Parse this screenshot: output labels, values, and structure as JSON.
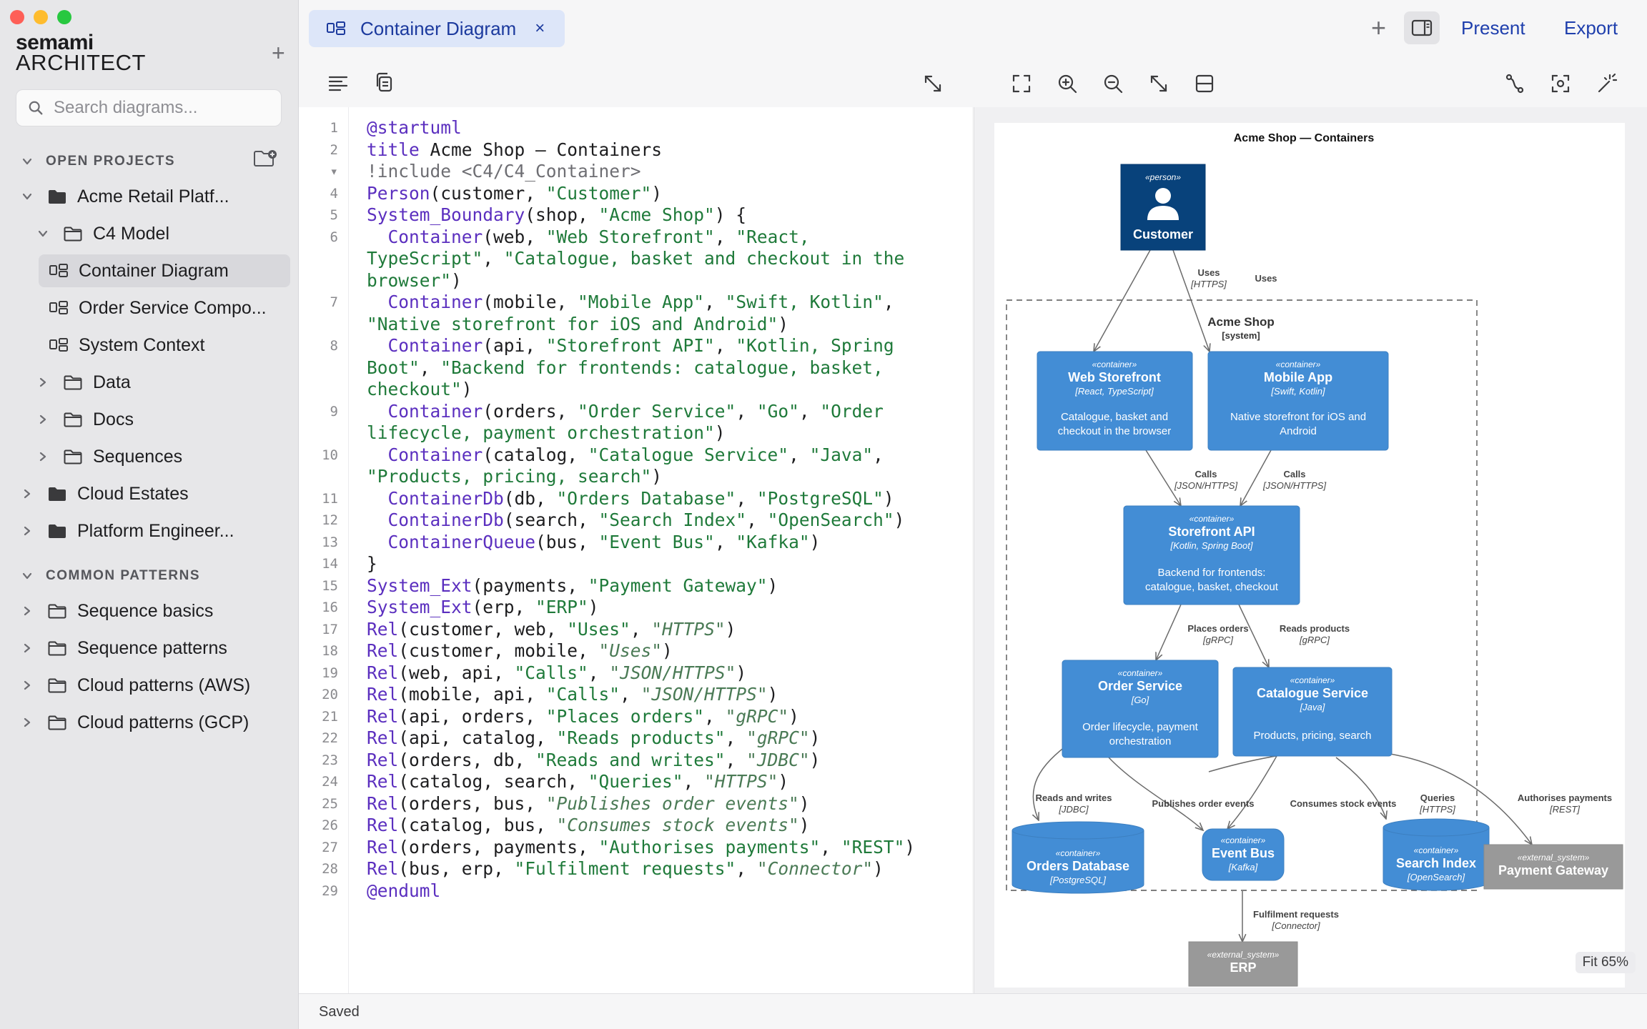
{
  "app": {
    "logo_line1": "semami",
    "logo_line2": "ARCHITECT",
    "traffic_colors": [
      "#fe5f57",
      "#febc2e",
      "#28c840"
    ]
  },
  "sidebar": {
    "search_placeholder": "Search diagrams...",
    "open_projects_header": "OPEN PROJECTS",
    "common_patterns_header": "COMMON PATTERNS",
    "open_projects": [
      {
        "label": "Acme Retail Platf...",
        "level": 0,
        "type": "folder-filled",
        "state": "expanded"
      },
      {
        "label": "C4 Model",
        "level": 1,
        "type": "folder",
        "state": "expanded"
      },
      {
        "label": "Container Diagram",
        "level": 2,
        "type": "diagram",
        "state": "leaf",
        "selected": true
      },
      {
        "label": "Order Service Compo...",
        "level": 2,
        "type": "diagram",
        "state": "leaf"
      },
      {
        "label": "System Context",
        "level": 2,
        "type": "diagram",
        "state": "leaf"
      },
      {
        "label": "Data",
        "level": 1,
        "type": "folder",
        "state": "collapsed"
      },
      {
        "label": "Docs",
        "level": 1,
        "type": "folder",
        "state": "collapsed"
      },
      {
        "label": "Sequences",
        "level": 1,
        "type": "folder",
        "state": "collapsed"
      },
      {
        "label": "Cloud Estates",
        "level": 0,
        "type": "folder-filled",
        "state": "collapsed"
      },
      {
        "label": "Platform Engineer...",
        "level": 0,
        "type": "folder-filled",
        "state": "collapsed"
      }
    ],
    "common_patterns": [
      {
        "label": "Sequence basics"
      },
      {
        "label": "Sequence patterns"
      },
      {
        "label": "Cloud patterns (AWS)"
      },
      {
        "label": "Cloud patterns (GCP)"
      }
    ]
  },
  "topbar": {
    "tab_label": "Container Diagram",
    "tab_close": "×",
    "add_symbol": "+",
    "present_label": "Present",
    "export_label": "Export"
  },
  "editor": {
    "lines": [
      {
        "n": "1",
        "parts": [
          [
            "at",
            "@startuml"
          ]
        ]
      },
      {
        "n": "2",
        "parts": [
          [
            "k",
            "title"
          ],
          [
            "",
            " Acme Shop — Containers"
          ]
        ]
      },
      {
        "n": "▾",
        "parts": [
          [
            "cm",
            "!include <C4/C4_Container>"
          ]
        ]
      },
      {
        "n": "4",
        "parts": [
          [
            "k",
            "Person"
          ],
          [
            "",
            "(customer, "
          ],
          [
            "s",
            "\"Customer\""
          ],
          [
            "",
            ")"
          ]
        ]
      },
      {
        "n": "5",
        "parts": [
          [
            "k",
            "System_Boundary"
          ],
          [
            "",
            "(shop, "
          ],
          [
            "s",
            "\"Acme Shop\""
          ],
          [
            "",
            ") {"
          ]
        ]
      },
      {
        "n": "6",
        "parts": [
          [
            "",
            "  "
          ],
          [
            "k",
            "Container"
          ],
          [
            "",
            "(web, "
          ],
          [
            "s",
            "\"Web Storefront\""
          ],
          [
            "",
            ", "
          ],
          [
            "s",
            "\"React,"
          ]
        ]
      },
      {
        "n": "",
        "parts": [
          [
            "s",
            "TypeScript\""
          ],
          [
            "",
            ", "
          ],
          [
            "s",
            "\"Catalogue, basket and checkout in the"
          ]
        ]
      },
      {
        "n": "",
        "parts": [
          [
            "s",
            "browser\""
          ],
          [
            "",
            ")"
          ]
        ]
      },
      {
        "n": "7",
        "parts": [
          [
            "",
            "  "
          ],
          [
            "k",
            "Container"
          ],
          [
            "",
            "(mobile, "
          ],
          [
            "s",
            "\"Mobile App\""
          ],
          [
            "",
            ", "
          ],
          [
            "s",
            "\"Swift, Kotlin\""
          ],
          [
            "",
            ","
          ]
        ]
      },
      {
        "n": "",
        "parts": [
          [
            "s",
            "\"Native storefront for iOS and Android\""
          ],
          [
            "",
            ")"
          ]
        ]
      },
      {
        "n": "8",
        "parts": [
          [
            "",
            "  "
          ],
          [
            "k",
            "Container"
          ],
          [
            "",
            "(api, "
          ],
          [
            "s",
            "\"Storefront API\""
          ],
          [
            "",
            ", "
          ],
          [
            "s",
            "\"Kotlin, Spring"
          ]
        ]
      },
      {
        "n": "",
        "parts": [
          [
            "s",
            "Boot\""
          ],
          [
            "",
            ", "
          ],
          [
            "s",
            "\"Backend for frontends: catalogue, basket,"
          ]
        ]
      },
      {
        "n": "",
        "parts": [
          [
            "s",
            "checkout\""
          ],
          [
            "",
            ")"
          ]
        ]
      },
      {
        "n": "9",
        "parts": [
          [
            "",
            "  "
          ],
          [
            "k",
            "Container"
          ],
          [
            "",
            "(orders, "
          ],
          [
            "s",
            "\"Order Service\""
          ],
          [
            "",
            ", "
          ],
          [
            "s",
            "\"Go\""
          ],
          [
            "",
            ", "
          ],
          [
            "s",
            "\"Order"
          ]
        ]
      },
      {
        "n": "",
        "parts": [
          [
            "s",
            "lifecycle, payment orchestration\""
          ],
          [
            "",
            ")"
          ]
        ]
      },
      {
        "n": "10",
        "parts": [
          [
            "",
            "  "
          ],
          [
            "k",
            "Container"
          ],
          [
            "",
            "(catalog, "
          ],
          [
            "s",
            "\"Catalogue Service\""
          ],
          [
            "",
            ", "
          ],
          [
            "s",
            "\"Java\""
          ],
          [
            "",
            ","
          ]
        ]
      },
      {
        "n": "",
        "parts": [
          [
            "s",
            "\"Products, pricing, search\""
          ],
          [
            "",
            ")"
          ]
        ]
      },
      {
        "n": "11",
        "parts": [
          [
            "",
            "  "
          ],
          [
            "k",
            "ContainerDb"
          ],
          [
            "",
            "(db, "
          ],
          [
            "s",
            "\"Orders Database\""
          ],
          [
            "",
            ", "
          ],
          [
            "s",
            "\"PostgreSQL\""
          ],
          [
            "",
            ")"
          ]
        ]
      },
      {
        "n": "12",
        "parts": [
          [
            "",
            "  "
          ],
          [
            "k",
            "ContainerDb"
          ],
          [
            "",
            "(search, "
          ],
          [
            "s",
            "\"Search Index\""
          ],
          [
            "",
            ", "
          ],
          [
            "s",
            "\"OpenSearch\""
          ],
          [
            "",
            ")"
          ]
        ]
      },
      {
        "n": "13",
        "parts": [
          [
            "",
            "  "
          ],
          [
            "k",
            "ContainerQueue"
          ],
          [
            "",
            "(bus, "
          ],
          [
            "s",
            "\"Event Bus\""
          ],
          [
            "",
            ", "
          ],
          [
            "s",
            "\"Kafka\""
          ],
          [
            "",
            ")"
          ]
        ]
      },
      {
        "n": "14",
        "parts": [
          [
            "",
            "}"
          ]
        ]
      },
      {
        "n": "15",
        "parts": [
          [
            "k",
            "System_Ext"
          ],
          [
            "",
            "(payments, "
          ],
          [
            "s",
            "\"Payment Gateway\""
          ],
          [
            "",
            ")"
          ]
        ]
      },
      {
        "n": "16",
        "parts": [
          [
            "k",
            "System_Ext"
          ],
          [
            "",
            "(erp, "
          ],
          [
            "s",
            "\"ERP\""
          ],
          [
            "",
            ")"
          ]
        ]
      },
      {
        "n": "17",
        "parts": [
          [
            "k",
            "Rel"
          ],
          [
            "",
            "(customer, web, "
          ],
          [
            "s",
            "\"Uses\""
          ],
          [
            "",
            ", "
          ],
          [
            "it",
            "\"HTTPS\""
          ],
          [
            "",
            ")"
          ]
        ]
      },
      {
        "n": "18",
        "parts": [
          [
            "k",
            "Rel"
          ],
          [
            "",
            "(customer, mobile, "
          ],
          [
            "it",
            "\"Uses\""
          ],
          [
            "",
            ")"
          ]
        ]
      },
      {
        "n": "19",
        "parts": [
          [
            "k",
            "Rel"
          ],
          [
            "",
            "(web, api, "
          ],
          [
            "s",
            "\"Calls\""
          ],
          [
            "",
            ", "
          ],
          [
            "it",
            "\"JSON/HTTPS\""
          ],
          [
            "",
            ")"
          ]
        ]
      },
      {
        "n": "20",
        "parts": [
          [
            "k",
            "Rel"
          ],
          [
            "",
            "(mobile, api, "
          ],
          [
            "s",
            "\"Calls\""
          ],
          [
            "",
            ", "
          ],
          [
            "it",
            "\"JSON/HTTPS\""
          ],
          [
            "",
            ")"
          ]
        ]
      },
      {
        "n": "21",
        "parts": [
          [
            "k",
            "Rel"
          ],
          [
            "",
            "(api, orders, "
          ],
          [
            "s",
            "\"Places orders\""
          ],
          [
            "",
            ", "
          ],
          [
            "it",
            "\"gRPC\""
          ],
          [
            "",
            ")"
          ]
        ]
      },
      {
        "n": "22",
        "parts": [
          [
            "k",
            "Rel"
          ],
          [
            "",
            "(api, catalog, "
          ],
          [
            "s",
            "\"Reads products\""
          ],
          [
            "",
            ", "
          ],
          [
            "it",
            "\"gRPC\""
          ],
          [
            "",
            ")"
          ]
        ]
      },
      {
        "n": "23",
        "parts": [
          [
            "k",
            "Rel"
          ],
          [
            "",
            "(orders, db, "
          ],
          [
            "s",
            "\"Reads and writes\""
          ],
          [
            "",
            ", "
          ],
          [
            "it",
            "\"JDBC\""
          ],
          [
            "",
            ")"
          ]
        ]
      },
      {
        "n": "24",
        "parts": [
          [
            "k",
            "Rel"
          ],
          [
            "",
            "(catalog, search, "
          ],
          [
            "s",
            "\"Queries\""
          ],
          [
            "",
            ", "
          ],
          [
            "it",
            "\"HTTPS\""
          ],
          [
            "",
            ")"
          ]
        ]
      },
      {
        "n": "25",
        "parts": [
          [
            "k",
            "Rel"
          ],
          [
            "",
            "(orders, bus, "
          ],
          [
            "it",
            "\"Publishes order events\""
          ],
          [
            "",
            ")"
          ]
        ]
      },
      {
        "n": "26",
        "parts": [
          [
            "k",
            "Rel"
          ],
          [
            "",
            "(catalog, bus, "
          ],
          [
            "it",
            "\"Consumes stock events\""
          ],
          [
            "",
            ")"
          ]
        ]
      },
      {
        "n": "27",
        "parts": [
          [
            "k",
            "Rel"
          ],
          [
            "",
            "(orders, payments, "
          ],
          [
            "s",
            "\"Authorises payments\""
          ],
          [
            "",
            ", "
          ],
          [
            "s",
            "\"REST\""
          ],
          [
            "",
            ")"
          ]
        ]
      },
      {
        "n": "28",
        "parts": [
          [
            "k",
            "Rel"
          ],
          [
            "",
            "(bus, erp, "
          ],
          [
            "s",
            "\"Fulfilment requests\""
          ],
          [
            "",
            ", "
          ],
          [
            "it",
            "\"Connector\""
          ],
          [
            "",
            ")"
          ]
        ]
      },
      {
        "n": "29",
        "parts": [
          [
            "at",
            "@enduml"
          ]
        ]
      }
    ]
  },
  "diagram": {
    "title": "Acme Shop — Containers",
    "boundary_name": "Acme Shop",
    "boundary_type": "[system]",
    "colors": {
      "person": "#08427b",
      "container": "#438dd5",
      "external": "#999999",
      "edge": "#6b6b6b"
    },
    "person": {
      "stereo": "«person»",
      "name": "Customer"
    },
    "nodes": {
      "web": {
        "stereo": "«container»",
        "name": "Web Storefront",
        "tech": "[React, TypeScript]",
        "desc1": "Catalogue, basket and",
        "desc2": "checkout in the browser"
      },
      "mobile": {
        "stereo": "«container»",
        "name": "Mobile App",
        "tech": "[Swift, Kotlin]",
        "desc1": "Native storefront for iOS and",
        "desc2": "Android"
      },
      "api": {
        "stereo": "«container»",
        "name": "Storefront API",
        "tech": "[Kotlin, Spring Boot]",
        "desc1": "Backend for frontends:",
        "desc2": "catalogue, basket, checkout"
      },
      "orders": {
        "stereo": "«container»",
        "name": "Order Service",
        "tech": "[Go]",
        "desc1": "Order lifecycle, payment",
        "desc2": "orchestration"
      },
      "catalog": {
        "stereo": "«container»",
        "name": "Catalogue Service",
        "tech": "[Java]",
        "desc1": "Products, pricing, search"
      },
      "db": {
        "stereo": "«container»",
        "name": "Orders Database",
        "tech": "[PostgreSQL]"
      },
      "bus": {
        "stereo": "«container»",
        "name": "Event Bus",
        "tech": "[Kafka]"
      },
      "search": {
        "stereo": "«container»",
        "name": "Search Index",
        "tech": "[OpenSearch]"
      },
      "payments": {
        "stereo": "«external_system»",
        "name": "Payment Gateway"
      },
      "erp": {
        "stereo": "«external_system»",
        "name": "ERP"
      }
    },
    "edges": {
      "cust_web": {
        "label": "Uses",
        "tech": "[HTTPS]"
      },
      "cust_mobile": {
        "label": "Uses"
      },
      "web_api": {
        "label": "Calls",
        "tech": "[JSON/HTTPS]"
      },
      "mobile_api": {
        "label": "Calls",
        "tech": "[JSON/HTTPS]"
      },
      "api_orders": {
        "label": "Places orders",
        "tech": "[gRPC]"
      },
      "api_catalog": {
        "label": "Reads products",
        "tech": "[gRPC]"
      },
      "orders_db": {
        "label": "Reads and writes",
        "tech": "[JDBC]"
      },
      "orders_bus": {
        "label": "Publishes order events"
      },
      "catalog_bus": {
        "label": "Consumes stock events"
      },
      "catalog_search": {
        "label": "Queries",
        "tech": "[HTTPS]"
      },
      "orders_payments": {
        "label": "Authorises payments",
        "tech": "[REST]"
      },
      "bus_erp": {
        "label": "Fulfilment requests",
        "tech": "[Connector]"
      }
    }
  },
  "preview": {
    "zoom_label": "Fit 65%"
  },
  "status": {
    "text": "Saved"
  }
}
